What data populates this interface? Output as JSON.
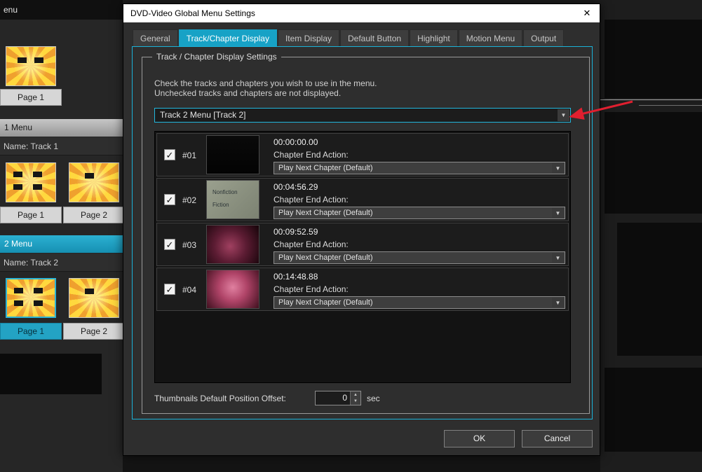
{
  "icons": {
    "check": "✓",
    "dropdown_arrow": "▼",
    "close": "✕",
    "spin_up": "▲",
    "spin_down": "▼"
  },
  "colors": {
    "accent": "#17a2c6",
    "annotation_arrow": "#e01f2f",
    "active_tab": "#17a2c6"
  },
  "background": {
    "top_label": "enu",
    "top_thumb_label": "Page 1",
    "track1": {
      "header": "1 Menu",
      "name": "Name: Track 1",
      "pages": [
        "Page 1",
        "Page 2"
      ]
    },
    "track2": {
      "header": "2 Menu",
      "name": "Name: Track 2",
      "pages": [
        "Page 1",
        "Page 2"
      ]
    }
  },
  "dialog": {
    "title": "DVD-Video Global Menu Settings",
    "tabs": [
      "General",
      "Track/Chapter Display",
      "Item Display",
      "Default Button",
      "Highlight",
      "Motion Menu",
      "Output"
    ],
    "active_tab": "Track/Chapter Display",
    "group_title": "Track / Chapter Display Settings",
    "instruction_line1": "Check the tracks and chapters you wish to use in the menu.",
    "instruction_line2": "Unchecked tracks and chapters are not displayed.",
    "track_selector_value": "Track 2 Menu [Track 2]",
    "chapter_end_action_label": "Chapter End Action:",
    "chapters": [
      {
        "id": "#01",
        "time": "00:00:00.00",
        "checked": true,
        "end_action": "Play Next Chapter (Default)"
      },
      {
        "id": "#02",
        "time": "00:04:56.29",
        "checked": true,
        "end_action": "Play Next Chapter (Default)",
        "thumb_text1": "Nonfiction",
        "thumb_text2": "Fiction"
      },
      {
        "id": "#03",
        "time": "00:09:52.59",
        "checked": true,
        "end_action": "Play Next Chapter (Default)"
      },
      {
        "id": "#04",
        "time": "00:14:48.88",
        "checked": true,
        "end_action": "Play Next Chapter (Default)"
      }
    ],
    "offset_label": "Thumbnails Default Position Offset:",
    "offset_value": "0",
    "offset_unit": "sec",
    "buttons": {
      "ok": "OK",
      "cancel": "Cancel"
    }
  }
}
